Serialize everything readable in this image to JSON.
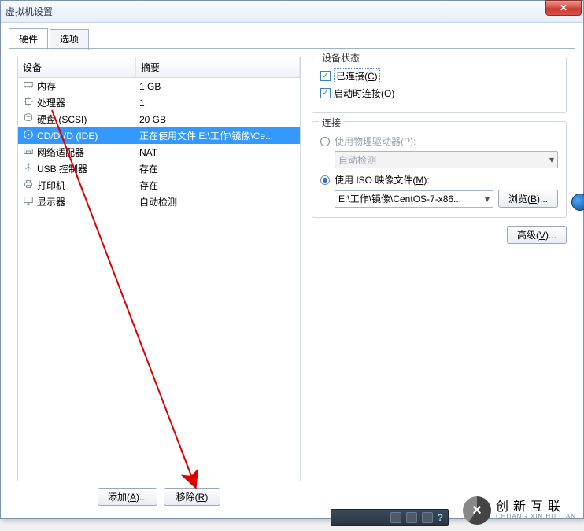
{
  "titlebar": {
    "title": "虚拟机设置"
  },
  "tabs": {
    "hw": "硬件",
    "opt": "选项"
  },
  "cols": {
    "device": "设备",
    "summary": "摘要"
  },
  "devices": [
    {
      "name": "内存",
      "summary": "1 GB",
      "icon": "memory"
    },
    {
      "name": "处理器",
      "summary": "1",
      "icon": "cpu"
    },
    {
      "name": "硬盘 (SCSI)",
      "summary": "20 GB",
      "icon": "disk"
    },
    {
      "name": "CD/DVD (IDE)",
      "summary": "正在使用文件 E:\\工作\\镜像\\Ce...",
      "icon": "cd",
      "selected": true
    },
    {
      "name": "网络适配器",
      "summary": "NAT",
      "icon": "nic"
    },
    {
      "name": "USB 控制器",
      "summary": "存在",
      "icon": "usb"
    },
    {
      "name": "打印机",
      "summary": "存在",
      "icon": "printer"
    },
    {
      "name": "显示器",
      "summary": "自动检测",
      "icon": "display"
    }
  ],
  "btns": {
    "add": "添加(",
    "add_key": "A",
    "add_tail": ")...",
    "remove_pre": "移除(",
    "remove_key": "R",
    "remove_tail": ")"
  },
  "status": {
    "group": "设备状态",
    "connected_pre": "已连接(",
    "connected_key": "C",
    "connected_tail": ")",
    "autostart_pre": "启动时连接(",
    "autostart_key": "O",
    "autostart_tail": ")"
  },
  "conn": {
    "group": "连接",
    "physical_pre": "使用物理驱动器(",
    "physical_key": "P",
    "physical_tail": "):",
    "auto": "自动检测",
    "iso_pre": "使用 ISO 映像文件(",
    "iso_key": "M",
    "iso_tail": "):",
    "iso_path": "E:\\工作\\镜像\\CentOS-7-x86...",
    "browse_pre": "浏览(",
    "browse_key": "B",
    "browse_tail": ")..."
  },
  "adv": {
    "pre": "高级(",
    "key": "V",
    "tail": ")..."
  },
  "logo": {
    "t1": "创新互联",
    "t2": "CHUANG XIN HU LIAN"
  }
}
